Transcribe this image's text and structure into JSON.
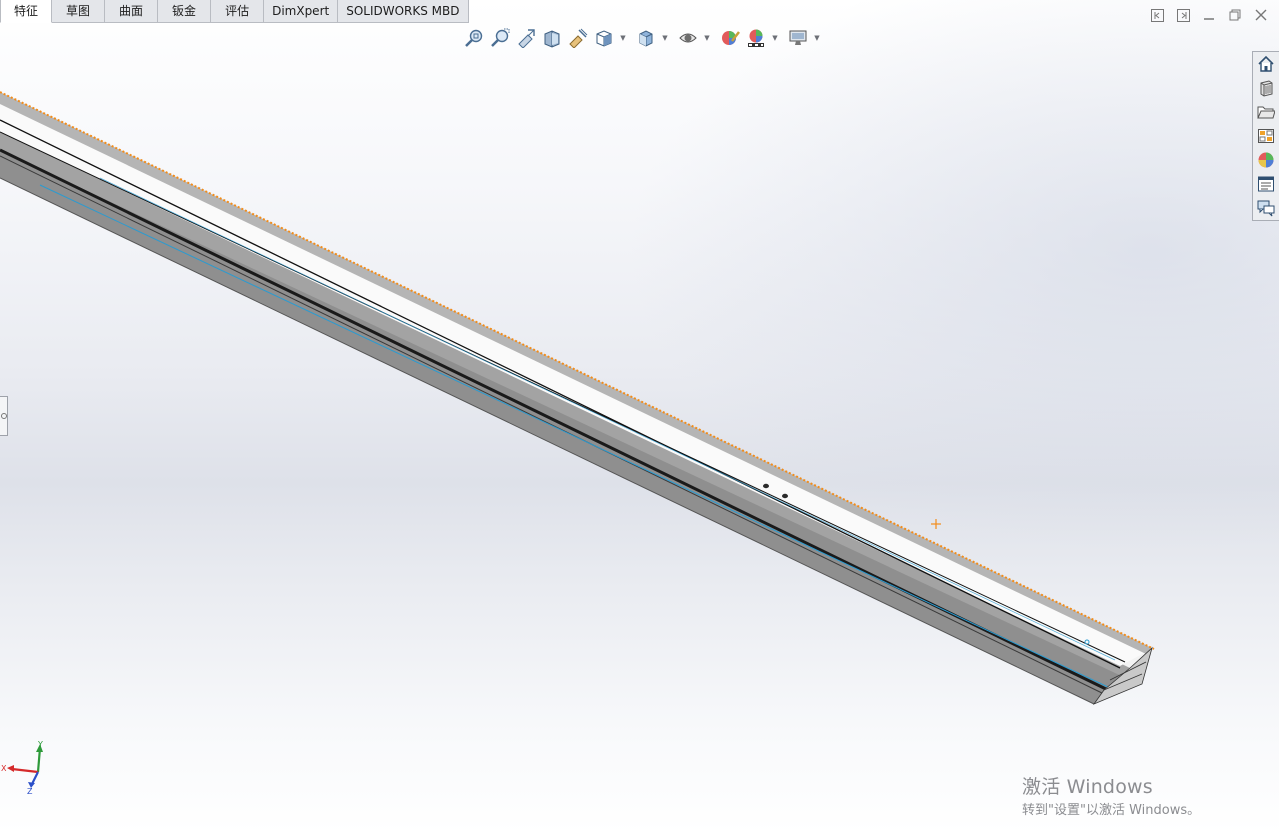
{
  "tabs": [
    {
      "label": "特征",
      "active": true
    },
    {
      "label": "草图"
    },
    {
      "label": "曲面"
    },
    {
      "label": "钣金"
    },
    {
      "label": "评估"
    },
    {
      "label": "DimXpert"
    },
    {
      "label": "SOLIDWORKS MBD"
    }
  ],
  "window_controls": {
    "icons": [
      "tile-left-icon",
      "tile-right-icon",
      "minimize-icon",
      "restore-icon",
      "close-icon"
    ]
  },
  "heads_up_toolbar": {
    "icons": [
      "zoom-to-fit-icon",
      "zoom-to-area-icon",
      "previous-view-icon",
      "section-view-icon",
      "dynamic-annotation-icon",
      "view-orientation-icon",
      "display-style-icon",
      "hide-show-items-icon",
      "edit-appearance-icon",
      "apply-scene-icon",
      "view-settings-icon"
    ]
  },
  "task_pane": {
    "icons": [
      "solidworks-resources-icon",
      "design-library-icon",
      "file-explorer-icon",
      "view-palette-icon",
      "appearances-icon",
      "custom-properties-icon",
      "forum-icon"
    ]
  },
  "triad": {
    "x_label": "X",
    "y_label": "Y",
    "z_label": "Z"
  },
  "watermark": {
    "title": "激活 Windows",
    "subtitle": "转到\"设置\"以激活 Windows。"
  },
  "colors": {
    "background_top": "#ffffff",
    "background_band": "#dee1e9",
    "highlight_orange": "#f28c1a",
    "edge_blue": "#2a9bd1",
    "steel_gray": "#a4a4a4"
  }
}
